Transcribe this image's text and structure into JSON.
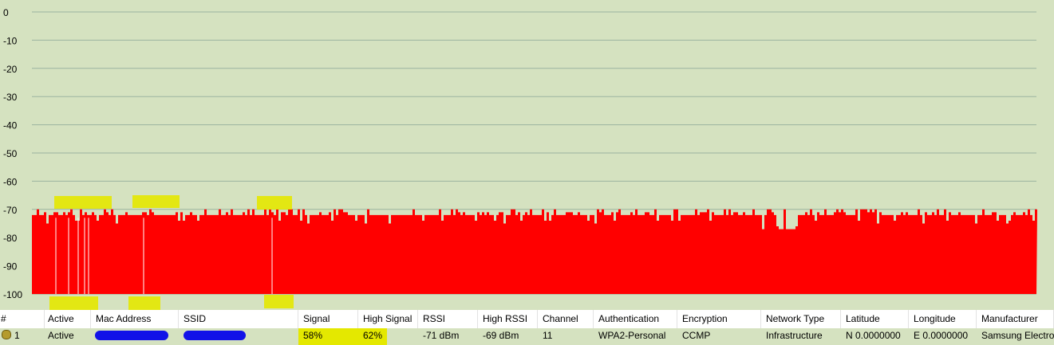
{
  "graph": {
    "yticks": [
      "0",
      "-10",
      "-20",
      "-30",
      "-40",
      "-50",
      "-60",
      "-70",
      "-80",
      "-90",
      "-100"
    ],
    "y_range": [
      -100,
      0
    ],
    "series_color": "#ff0000",
    "background_color": "#d5e2c0",
    "grid_color": "#9bb3a0",
    "highlight_color": "#e4e800"
  },
  "chart_data": {
    "type": "area",
    "title": "",
    "xlabel": "",
    "ylabel": "",
    "ylim": [
      -100,
      0
    ],
    "grid": true,
    "series": [
      {
        "name": "",
        "color": "#ff0000",
        "typical_value": -72,
        "max_value": -69,
        "min_value": -77
      }
    ]
  },
  "table": {
    "headers": [
      "#",
      "Active",
      "Mac Address",
      "SSID",
      "Signal",
      "High Signal",
      "RSSI",
      "High RSSI",
      "Channel",
      "Authentication",
      "Encryption",
      "Network Type",
      "Latitude",
      "Longitude",
      "Manufacturer"
    ],
    "rows": [
      {
        "index": "1",
        "active": "Active",
        "mac": "",
        "ssid": "",
        "signal": "58%",
        "high_signal": "62%",
        "rssi": "-71 dBm",
        "high_rssi": "-69 dBm",
        "channel": "11",
        "authentication": "WPA2-Personal",
        "encryption": "CCMP",
        "network_type": "Infrastructure",
        "latitude": "N 0.0000000",
        "longitude": "E 0.0000000",
        "manufacturer": "Samsung Electro M"
      }
    ]
  }
}
